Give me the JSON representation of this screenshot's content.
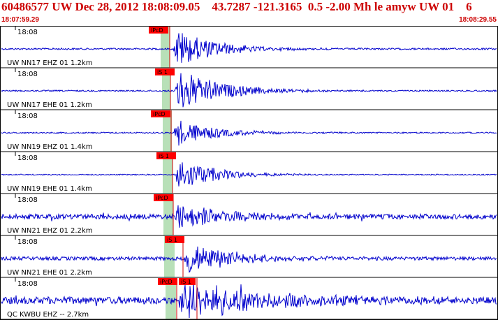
{
  "header": {
    "title": "60486577 UW Dec 28, 2012 18:08:09.05    43.7287 -121.3165  0.5 -2.00 Mh le amyw UW 01    6",
    "time_start": "18:07:59.29",
    "time_end": "18:08:29.55"
  },
  "colors": {
    "trace": "#0000cc",
    "pick_box": "#ff0000",
    "pick_line": "#cc0000",
    "window_shade": "#b8e0b8",
    "header_text": "#cc0000",
    "frame": "#000000"
  },
  "traces": [
    {
      "tick_label": "18:08",
      "station_label": "UW NN17 EHZ 01 1.2km",
      "pick_label": "iPcD",
      "pick2_label": ""
    },
    {
      "tick_label": "18:08",
      "station_label": "UW NN17 EHE 01 1.2km",
      "pick_label": "iS 1",
      "pick2_label": ""
    },
    {
      "tick_label": "18:08",
      "station_label": "UW NN19 EHZ 01 1.4km",
      "pick_label": "iPcD",
      "pick2_label": ""
    },
    {
      "tick_label": "18:08",
      "station_label": "UW NN19 EHE 01 1.4km",
      "pick_label": "iS 1",
      "pick2_label": ""
    },
    {
      "tick_label": "18:08",
      "station_label": "UW NN21 EHZ 01 2.2km",
      "pick_label": "iPcD",
      "pick2_label": ""
    },
    {
      "tick_label": "18:08",
      "station_label": "UW NN21 EHE 01 2.2km",
      "pick_label": "iS 1",
      "pick2_label": ""
    },
    {
      "tick_label": "18:08",
      "station_label": "QC KWBU EHZ -- 2.7km",
      "pick_label": "iPcD",
      "pick2_label": "iS 1"
    }
  ]
}
